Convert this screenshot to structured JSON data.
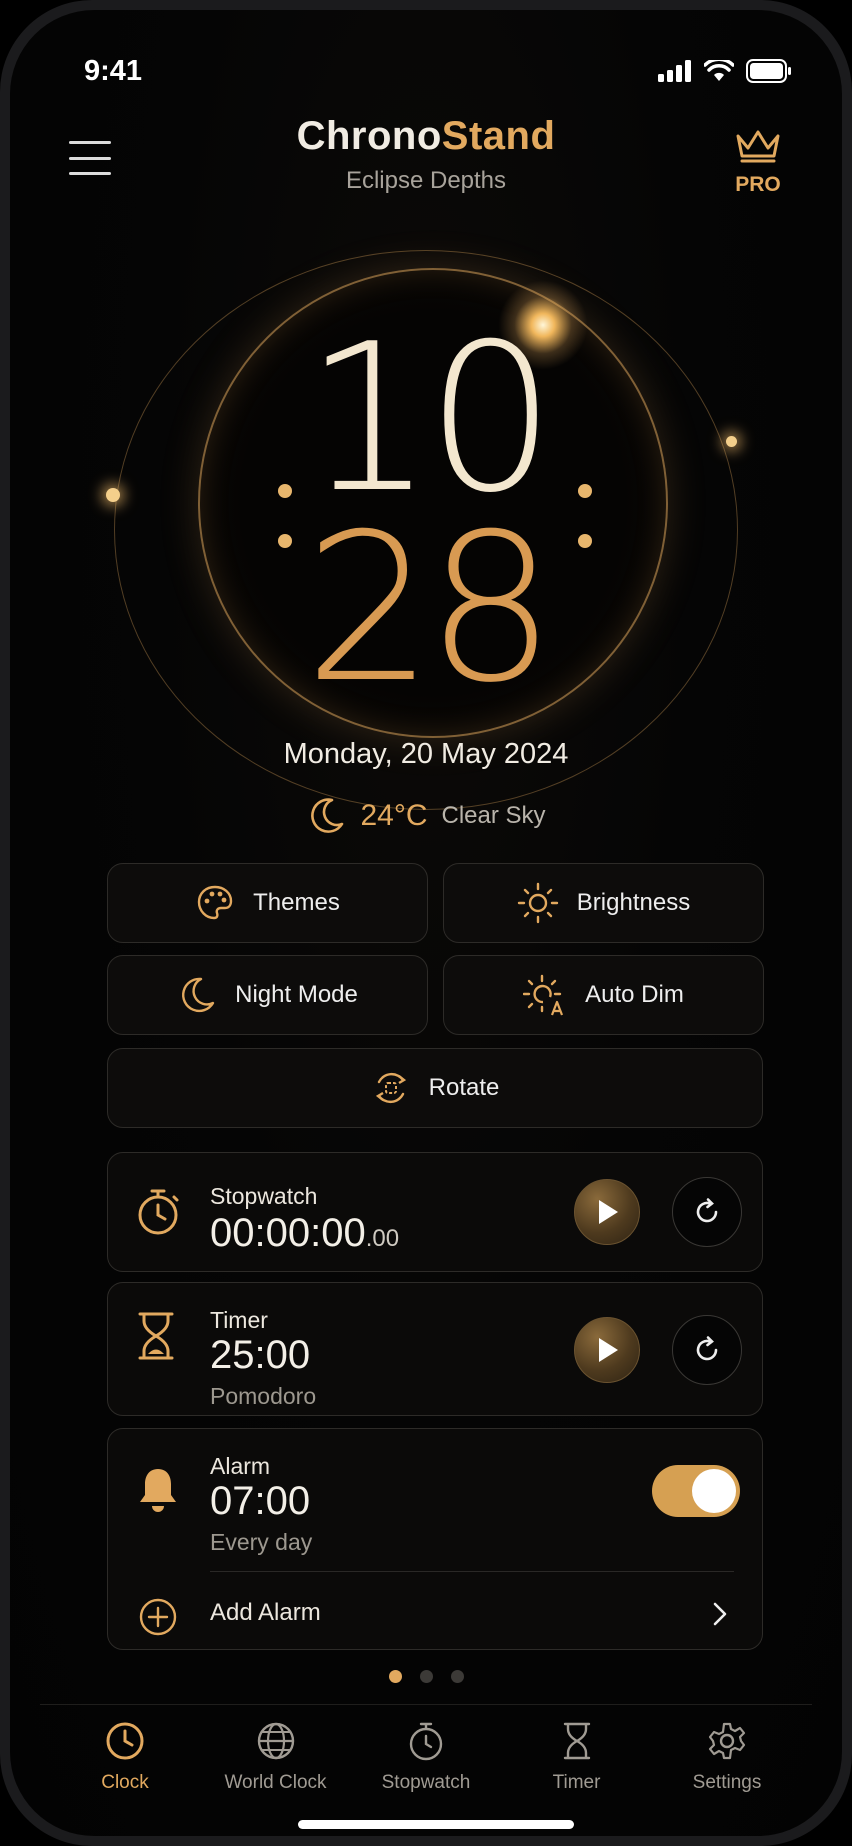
{
  "status_bar": {
    "time": "9:41"
  },
  "header": {
    "title_part1": "Chrono",
    "title_part2": "Stand",
    "subtitle": "Eclipse Depths",
    "pro_label": "PRO"
  },
  "clock": {
    "hours": "10",
    "minutes": "28"
  },
  "date": "Monday, 20 May 2024",
  "weather": {
    "temp": "24°C",
    "condition": "Clear Sky"
  },
  "quick_actions": {
    "themes": "Themes",
    "brightness": "Brightness",
    "night_mode": "Night Mode",
    "auto_dim": "Auto Dim",
    "rotate": "Rotate"
  },
  "stopwatch": {
    "label": "Stopwatch",
    "value": "00:00:00",
    "fraction": ".00"
  },
  "timer": {
    "label": "Timer",
    "value": "25:00",
    "preset": "Pomodoro"
  },
  "alarm": {
    "label": "Alarm",
    "time": "07:00",
    "repeat": "Every day",
    "enabled": true,
    "add_label": "Add Alarm"
  },
  "pager": {
    "pages": 3,
    "active": 1
  },
  "tabs": [
    {
      "label": "Clock",
      "icon": "clock-icon",
      "active": true
    },
    {
      "label": "World Clock",
      "icon": "globe-icon",
      "active": false
    },
    {
      "label": "Stopwatch",
      "icon": "stopwatch-icon",
      "active": false
    },
    {
      "label": "Timer",
      "icon": "hourglass-icon",
      "active": false
    },
    {
      "label": "Settings",
      "icon": "gear-icon",
      "active": false
    }
  ],
  "colors": {
    "accent": "#e2a95f",
    "background": "#050505"
  }
}
